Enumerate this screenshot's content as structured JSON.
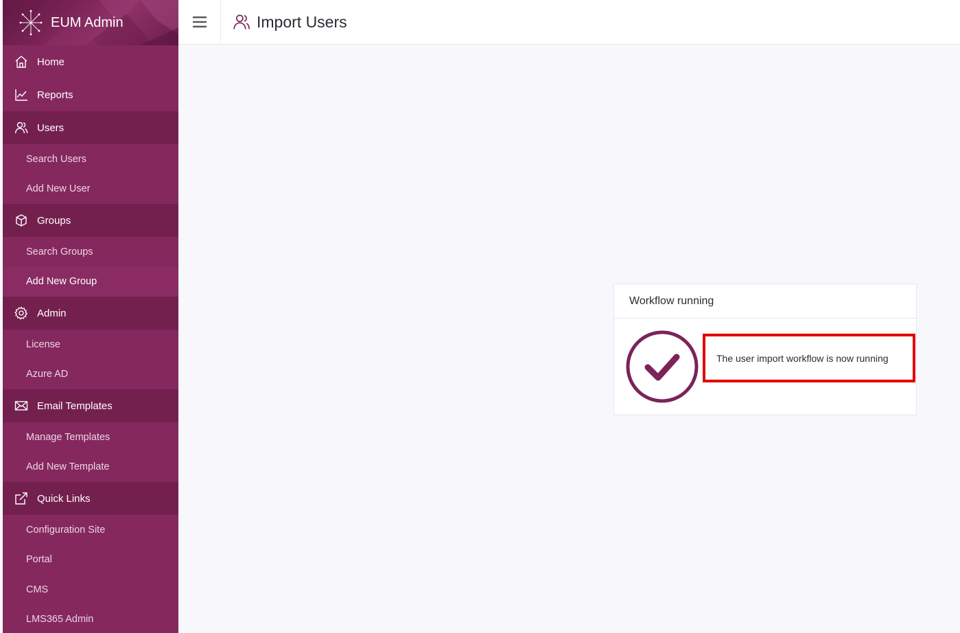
{
  "brand": {
    "title": "EUM Admin"
  },
  "header": {
    "page_title": "Import Users"
  },
  "sidebar": {
    "items": [
      {
        "type": "section",
        "label": "Home",
        "icon": "home-icon"
      },
      {
        "type": "section",
        "label": "Reports",
        "icon": "chart-icon"
      },
      {
        "type": "section",
        "label": "Users",
        "icon": "users-icon"
      },
      {
        "type": "sub",
        "label": "Search Users"
      },
      {
        "type": "sub",
        "label": "Add New User"
      },
      {
        "type": "section",
        "label": "Groups",
        "icon": "cube-icon"
      },
      {
        "type": "sub",
        "label": "Search Groups"
      },
      {
        "type": "sub",
        "label": "Add New Group"
      },
      {
        "type": "section",
        "label": "Admin",
        "icon": "gear-icon"
      },
      {
        "type": "sub",
        "label": "License"
      },
      {
        "type": "sub",
        "label": "Azure AD"
      },
      {
        "type": "section",
        "label": "Email Templates",
        "icon": "mail-icon"
      },
      {
        "type": "sub",
        "label": "Manage Templates"
      },
      {
        "type": "sub",
        "label": "Add New Template"
      },
      {
        "type": "section",
        "label": "Quick Links",
        "icon": "external-link-icon"
      },
      {
        "type": "sub",
        "label": "Configuration Site"
      },
      {
        "type": "sub",
        "label": "Portal"
      },
      {
        "type": "sub",
        "label": "CMS"
      },
      {
        "type": "sub",
        "label": "LMS365 Admin"
      }
    ]
  },
  "card": {
    "title": "Workflow running",
    "message": "The user import workflow is now running"
  },
  "colors": {
    "brand": "#85285e",
    "accent_dark": "#74204f",
    "highlight_border": "#e00000",
    "check": "#7a2459"
  }
}
